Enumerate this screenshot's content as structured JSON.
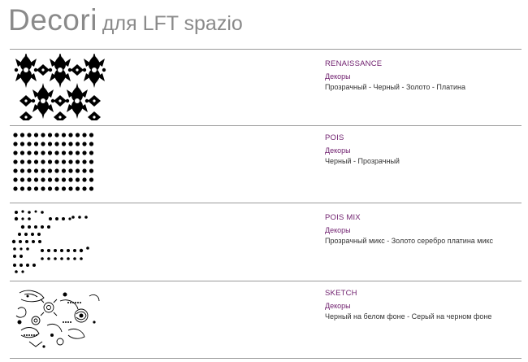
{
  "header": {
    "title_main": "Decori",
    "title_sub": "для LFT spazio"
  },
  "items": [
    {
      "name": "RENAISSANCE",
      "category": "Декоры",
      "options": "Прозрачный - Черный - Золото - Платина",
      "pattern": "damask-pattern"
    },
    {
      "name": "POIS",
      "category": "Декоры",
      "options": "Черный - Прозрачный",
      "pattern": "dot-grid-pattern"
    },
    {
      "name": "POIS MIX",
      "category": "Декоры",
      "options": "Прозрачный микс - Золото серебро платина микс",
      "pattern": "mixed-dots-pattern"
    },
    {
      "name": "SKETCH",
      "category": "Декоры",
      "options": "Черный на белом фоне - Серый на черном фоне",
      "pattern": "sketch-floral-pattern"
    }
  ],
  "colors": {
    "title": "#8a8a8a",
    "accent": "#6f1f6e",
    "text": "#333333",
    "rule": "#9a9a9a"
  }
}
